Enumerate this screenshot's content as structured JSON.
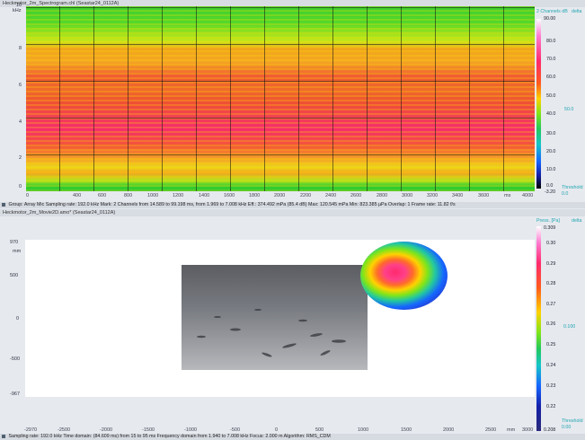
{
  "spectrogram": {
    "title": "Heckmotor_2m_Spectrogram.chl (Seastar24_0112A)",
    "y_unit": "kHz",
    "y_ticks": [
      "10",
      "8",
      "6",
      "4",
      "2",
      "0"
    ],
    "x_ticks": [
      "0",
      "400",
      "600",
      "800",
      "1000",
      "1200",
      "1400",
      "1600",
      "1800",
      "2000",
      "2200",
      "2400",
      "2600",
      "2800",
      "3000",
      "3200",
      "3400",
      "3600",
      "ms",
      "4000"
    ],
    "colorbar_header_left": "2 Channels dB",
    "colorbar_header_right": "delta",
    "colorbar_ticks": [
      "90.00",
      "80.0",
      "70.0",
      "60.0",
      "50.0",
      "40.0",
      "30.0",
      "20.0",
      "10.0",
      "0.0",
      "-3.20"
    ],
    "colorbar_side_value": "50.0",
    "colorbar_threshold_label": "Threshold",
    "colorbar_threshold_value": "0.0",
    "status": "Group: Array Mic  Sampling rate: 192.0 kHz  Mark: 2 Channels from 14.589 to 99.198 ms, from 1.969 to 7.008 kHz   Eff.: 374.492 mPa (85.4 dB)  Max: 120.545 mPa  Min: 823.385 µPa  Overlap: 1  Frame rate: 11.82 f/s"
  },
  "acoustic_map": {
    "title": "Heckmotor_2m_Movie2D.amo* (Seastar24_0112A)",
    "y_unit": "mm",
    "y_ticks": [
      "970",
      "500",
      "0",
      "-500",
      "-967"
    ],
    "x_ticks": [
      "-2970",
      "-2500",
      "-2000",
      "-1500",
      "-1000",
      "-500",
      "0",
      "500",
      "1000",
      "1500",
      "2000",
      "2500",
      "mm",
      "3000"
    ],
    "colorbar_header_left": "Press. [Pa]",
    "colorbar_header_right": "delta",
    "colorbar_ticks": [
      "0.309",
      "0.30",
      "0.29",
      "0.28",
      "0.27",
      "0.26",
      "0.25",
      "0.24",
      "0.23",
      "0.22",
      "0.208"
    ],
    "colorbar_side_value": "0.100",
    "colorbar_threshold_label": "Threshold",
    "colorbar_threshold_value": "0.00",
    "status": "Sampling rate: 192.0 kHz  Time domain: (84.609 ms) from 15 to 95 ms   Frequency domain from 1.940 to 7.008 kHz  Focus: 2.000 m  Algorithm: RMS_CDM"
  }
}
